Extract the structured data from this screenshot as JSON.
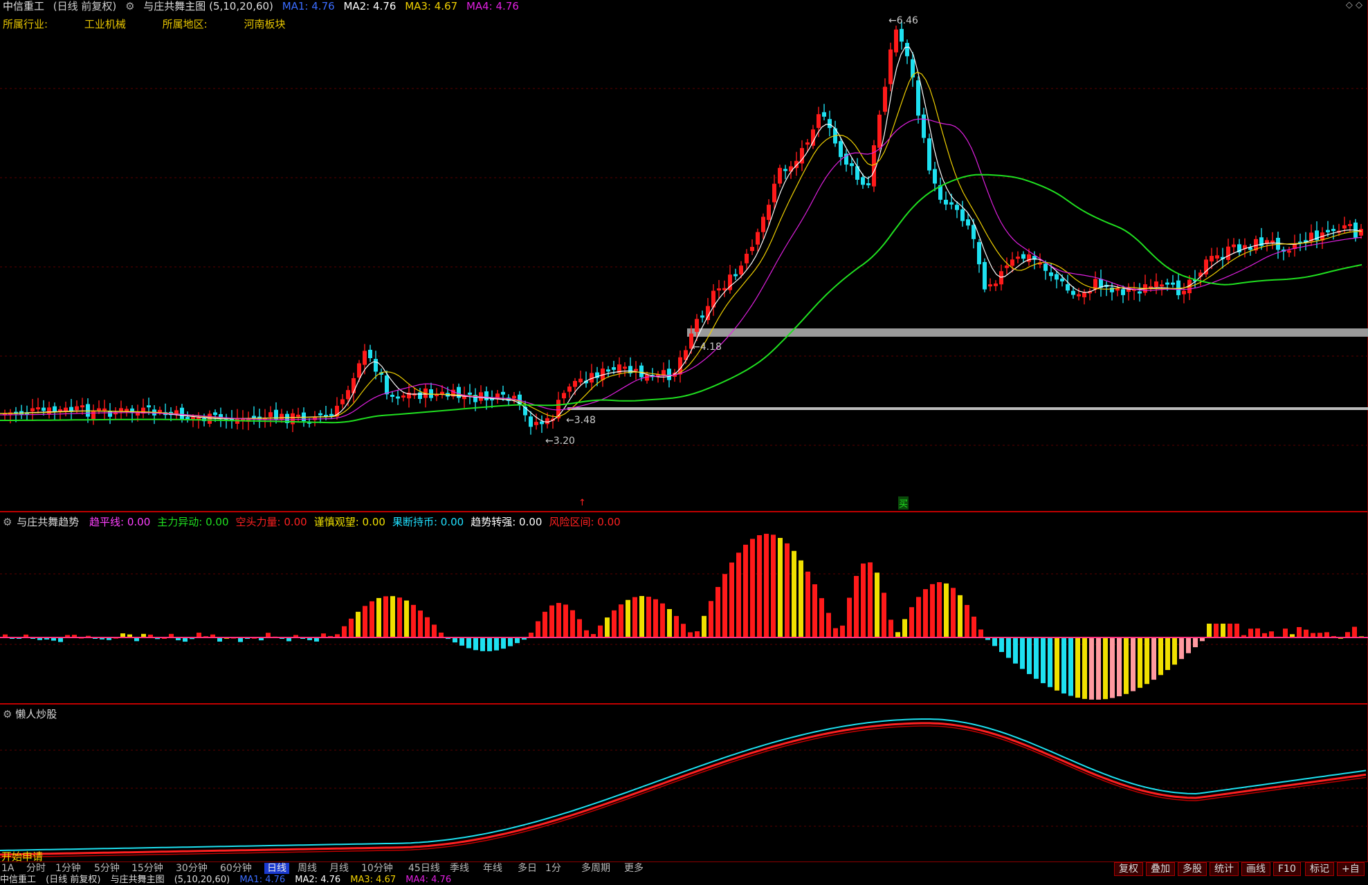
{
  "header": {
    "stock_name": "中信重工",
    "chart_mode": "(日线 前复权)",
    "indicator_name": "与庄共舞主图",
    "params": "(5,10,20,60)",
    "ma1": "MA1: 4.76",
    "ma2": "MA2: 4.76",
    "ma3": "MA3: 4.67",
    "ma4": "MA4: 4.76",
    "corner_icons": "◇ ◇"
  },
  "industry": {
    "label1": "所属行业:",
    "value1": "工业机械",
    "label2": "所属地区:",
    "value2": "河南板块"
  },
  "price_labels": {
    "high": "6.46",
    "mid": "4.18",
    "low_box": "3.48",
    "low": "3.20"
  },
  "indicator1": {
    "title": "与庄共舞趋势",
    "items": [
      {
        "label": "趋平线: 0.00",
        "color": "#ff40ff"
      },
      {
        "label": "主力异动: 0.00",
        "color": "#20e020"
      },
      {
        "label": "空头力量: 0.00",
        "color": "#ff2020"
      },
      {
        "label": "谨慎观望: 0.00",
        "color": "#f0e000"
      },
      {
        "label": "果断持币: 0.00",
        "color": "#20e0ff"
      },
      {
        "label": "趋势转强: 0.00",
        "color": "#ffffff"
      },
      {
        "label": "风险区间: 0.00",
        "color": "#ff2020"
      }
    ]
  },
  "indicator2": {
    "title": "懒人炒股"
  },
  "start_label": "开始申请",
  "bottom_tabs": [
    "1A",
    "分时",
    "1分钟",
    "5分钟",
    "15分钟",
    "30分钟",
    "60分钟",
    "日线",
    "周线",
    "月线",
    "10分钟",
    "45日线",
    "季线",
    "年线",
    "多日",
    "1分",
    "多周期",
    "更多"
  ],
  "active_tab": "日线",
  "right_tabs": [
    "复权",
    "叠加",
    "多股",
    "统计",
    "画线",
    "F10",
    "标记",
    "+自"
  ],
  "status_line": {
    "stock_name": "中信重工",
    "mode": "(日线 前复权)",
    "indicator": "与庄共舞主图",
    "params": "(5,10,20,60)",
    "ma1": "MA1: 4.76",
    "ma2": "MA2: 4.76",
    "ma3": "MA3: 4.67",
    "ma4": "MA4: 4.76"
  },
  "colors": {
    "up": "#ff1a1a",
    "down": "#1ee0f0",
    "ma5": "#ffffff",
    "ma10": "#f0d000",
    "ma20": "#e020e0",
    "ma60": "#20e020",
    "gray_band": "#9a9a9a"
  }
}
